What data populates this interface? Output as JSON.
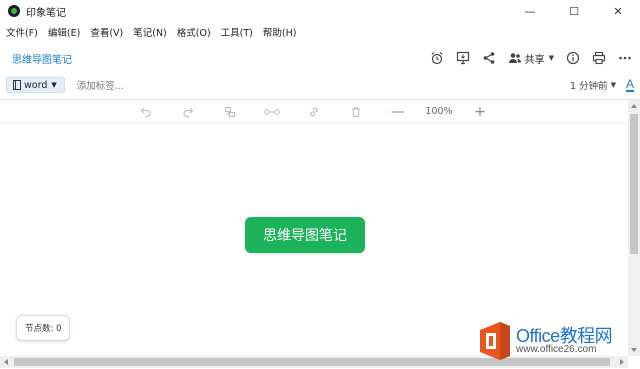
{
  "window": {
    "title": "印象笔记",
    "controls": {
      "minimize": "—",
      "maximize": "☐",
      "close": "✕"
    }
  },
  "menu": {
    "items": [
      "文件(F)",
      "编辑(E)",
      "查看(V)",
      "笔记(N)",
      "格式(O)",
      "工具(T)",
      "帮助(H)"
    ]
  },
  "note": {
    "title": "思维导图笔记",
    "share_label": "共享"
  },
  "tags": {
    "notebook": "word",
    "tag_placeholder": "添加标签...",
    "modified": "1 分钟前",
    "font_icon_label": "A"
  },
  "toolbar": {
    "zoom_minus": "—",
    "zoom_value": "100%",
    "zoom_plus": "+"
  },
  "mindmap": {
    "root_node": "思维导图笔记",
    "node_count": "节点数: 0"
  },
  "watermark": {
    "text": "Office教程网",
    "url": "www.office26.com"
  },
  "colors": {
    "accent": "#1b7fd0",
    "node_green": "#1db35a",
    "watermark_orange": "#e8561e"
  }
}
